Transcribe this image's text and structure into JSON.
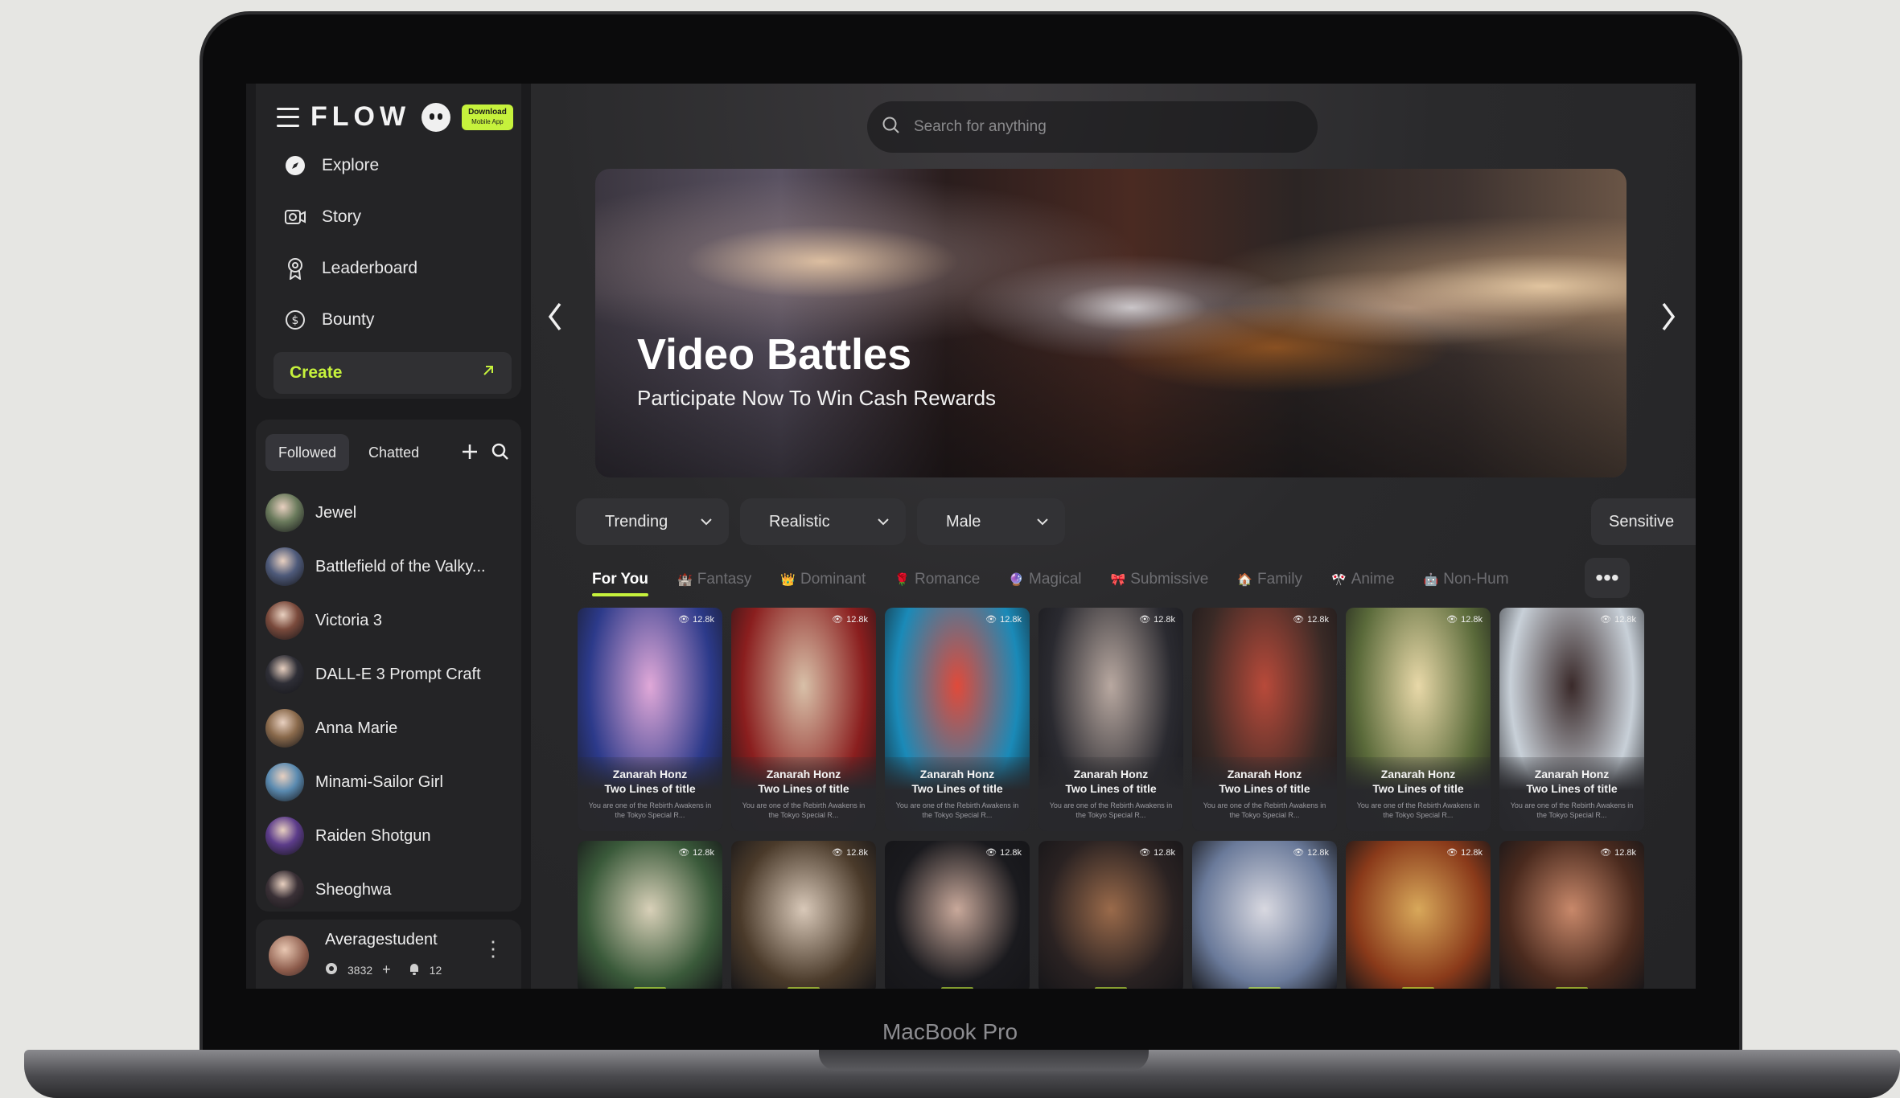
{
  "app": {
    "logo": "FLOW",
    "download_badge": "Download",
    "download_badge_sub": "Mobile App"
  },
  "sidebar": {
    "nav": [
      {
        "label": "Explore",
        "icon": "compass-icon"
      },
      {
        "label": "Story",
        "icon": "story-icon"
      },
      {
        "label": "Leaderboard",
        "icon": "medal-icon"
      },
      {
        "label": "Bounty",
        "icon": "dollar-icon"
      }
    ],
    "create_label": "Create",
    "tabs": [
      "Followed",
      "Chatted"
    ],
    "chats": [
      {
        "name": "Jewel",
        "color": "#6a7a5c"
      },
      {
        "name": "Battlefield of the Valky...",
        "color": "#4e5a7a"
      },
      {
        "name": "Victoria 3",
        "color": "#7a4a3c"
      },
      {
        "name": "DALL-E 3 Prompt Craft",
        "color": "#2e2e36"
      },
      {
        "name": "Anna Marie",
        "color": "#8a6a4c"
      },
      {
        "name": "Minami-Sailor Girl",
        "color": "#5a8ab0"
      },
      {
        "name": "Raiden Shotgun",
        "color": "#5c3c8a"
      },
      {
        "name": "Sheoghwa",
        "color": "#3a3036"
      }
    ],
    "user": {
      "name": "Averagestudent",
      "coins": "3832",
      "notifications": "12"
    }
  },
  "main": {
    "search_placeholder": "Search for anything",
    "banner": {
      "title": "Video Battles",
      "subtitle": "Participate Now To Win Cash Rewards"
    },
    "filters": [
      "Trending",
      "Realistic",
      "Male"
    ],
    "sensitive_label": "Sensitive",
    "sensitive_on": true,
    "genres": [
      {
        "label": "For You",
        "icon": ""
      },
      {
        "label": "Fantasy",
        "icon": "🏰"
      },
      {
        "label": "Dominant",
        "icon": "👑"
      },
      {
        "label": "Romance",
        "icon": "🌹"
      },
      {
        "label": "Magical",
        "icon": "🔮"
      },
      {
        "label": "Submissive",
        "icon": "🎀"
      },
      {
        "label": "Family",
        "icon": "🏠"
      },
      {
        "label": "Anime",
        "icon": "🎌"
      },
      {
        "label": "Non-Hum",
        "icon": "🤖"
      }
    ],
    "more_label": "•••",
    "cards_row1": [
      {
        "views": "12.8k",
        "name": "Zanarah Honz",
        "title": "Two Lines of title",
        "desc": "You are one of the Rebirth Awakens in the Tokyo Special R...",
        "c1": "#2c3a8a",
        "c2": "#e0a8d8"
      },
      {
        "views": "12.8k",
        "name": "Zanarah Honz",
        "title": "Two Lines of title",
        "desc": "You are one of the Rebirth Awakens in the Tokyo Special R...",
        "c1": "#8a1e1e",
        "c2": "#d8c0a8"
      },
      {
        "views": "12.8k",
        "name": "Zanarah Honz",
        "title": "Two Lines of title",
        "desc": "You are one of the Rebirth Awakens in the Tokyo Special R...",
        "c1": "#1a8ab8",
        "c2": "#e04a3a"
      },
      {
        "views": "12.8k",
        "name": "Zanarah Honz",
        "title": "Two Lines of title",
        "desc": "You are one of the Rebirth Awakens in the Tokyo Special R...",
        "c1": "#2a2a30",
        "c2": "#b8a8a0"
      },
      {
        "views": "12.8k",
        "name": "Zanarah Honz",
        "title": "Two Lines of title",
        "desc": "You are one of the Rebirth Awakens in the Tokyo Special R...",
        "c1": "#3a2a26",
        "c2": "#b84a3a"
      },
      {
        "views": "12.8k",
        "name": "Zanarah Honz",
        "title": "Two Lines of title",
        "desc": "You are one of the Rebirth Awakens in the Tokyo Special R...",
        "c1": "#5a6a3a",
        "c2": "#e8d8a8"
      },
      {
        "views": "12.8k",
        "name": "Zanarah Honz",
        "title": "Two Lines of title",
        "desc": "You are one of the Rebirth Awakens in the Tokyo Special R...",
        "c1": "#c8d0d8",
        "c2": "#3a2a2a"
      }
    ],
    "cards_row2": [
      {
        "views": "12.8k",
        "c1": "#3a5a3a",
        "c2": "#d8d0b8"
      },
      {
        "views": "12.8k",
        "c1": "#4a3a2a",
        "c2": "#d8c8b8"
      },
      {
        "views": "12.8k",
        "c1": "#1a1a1e",
        "c2": "#c8a89a"
      },
      {
        "views": "12.8k",
        "c1": "#2a2222",
        "c2": "#9a6a4a"
      },
      {
        "views": "12.8k",
        "c1": "#6a7a9a",
        "c2": "#d8d8e0"
      },
      {
        "views": "12.8k",
        "c1": "#8a3a1a",
        "c2": "#d8a85a"
      },
      {
        "views": "12.8k",
        "c1": "#4a2a1e",
        "c2": "#c8886a"
      }
    ]
  },
  "device_label": "MacBook Pro",
  "colors": {
    "accent": "#c6f23c",
    "panel": "#242426",
    "background": "#1b1b1d"
  }
}
